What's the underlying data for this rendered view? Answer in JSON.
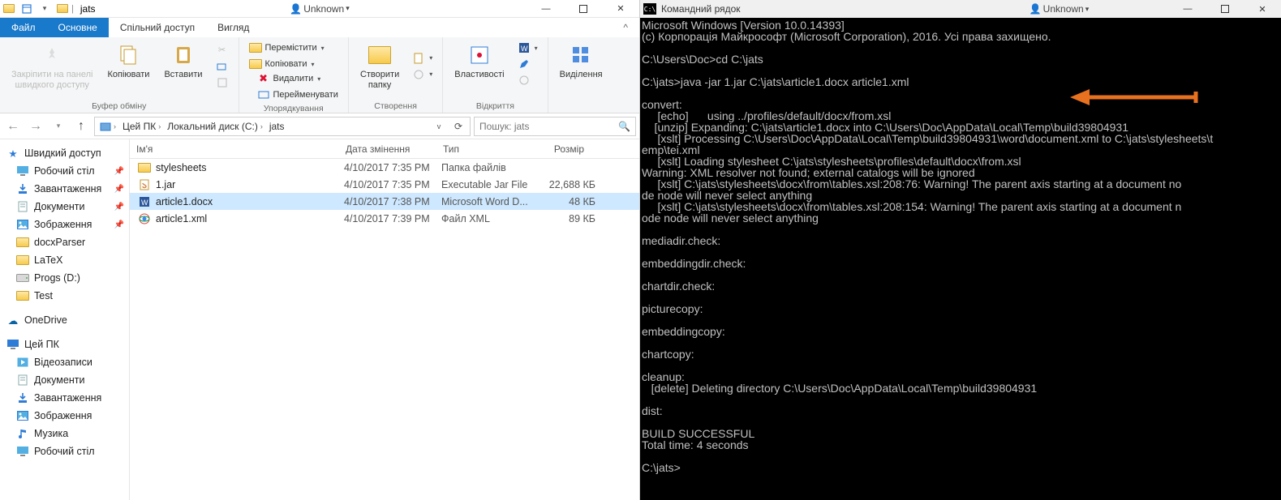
{
  "explorer": {
    "title": "jats",
    "unknown_label": "Unknown",
    "tabs": {
      "file": "Файл",
      "home": "Основне",
      "share": "Спільний доступ",
      "view": "Вигляд"
    },
    "ribbon": {
      "clipboard": {
        "pin": "Закріпити на панелі\nшвидкого доступу",
        "copy": "Копіювати",
        "paste": "Вставити",
        "group": "Буфер обміну"
      },
      "organize": {
        "move": "Перемістити",
        "copyto": "Копіювати",
        "delete": "Видалити",
        "rename": "Перейменувати",
        "group": "Упорядкування"
      },
      "new": {
        "newfolder": "Створити\nпапку",
        "group": "Створення"
      },
      "open": {
        "properties": "Властивості",
        "group": "Відкриття"
      },
      "select": {
        "select": "Виділення"
      }
    },
    "breadcrumb": [
      "Цей ПК",
      "Локальний диск (C:)",
      "jats"
    ],
    "search_placeholder": "Пошук: jats",
    "columns": {
      "name": "Ім'я",
      "date": "Дата змінення",
      "type": "Тип",
      "size": "Розмір"
    },
    "sidebar": {
      "quick": "Швидкий доступ",
      "quick_items": [
        {
          "label": "Робочий стіл",
          "icon": "desktop",
          "pinned": true
        },
        {
          "label": "Завантаження",
          "icon": "downloads",
          "pinned": true
        },
        {
          "label": "Документи",
          "icon": "documents",
          "pinned": true
        },
        {
          "label": "Зображення",
          "icon": "pictures",
          "pinned": true
        },
        {
          "label": "docxParser",
          "icon": "folder",
          "pinned": false
        },
        {
          "label": "LaTeX",
          "icon": "folder",
          "pinned": false
        },
        {
          "label": "Progs (D:)",
          "icon": "drive",
          "pinned": false
        },
        {
          "label": "Test",
          "icon": "folder",
          "pinned": false
        }
      ],
      "onedrive": "OneDrive",
      "thispc": "Цей ПК",
      "pc_items": [
        {
          "label": "Відеозаписи",
          "icon": "videos"
        },
        {
          "label": "Документи",
          "icon": "documents"
        },
        {
          "label": "Завантаження",
          "icon": "downloads"
        },
        {
          "label": "Зображення",
          "icon": "pictures"
        },
        {
          "label": "Музика",
          "icon": "music"
        },
        {
          "label": "Робочий стіл",
          "icon": "desktop"
        }
      ]
    },
    "files": [
      {
        "name": "stylesheets",
        "date": "4/10/2017 7:35 PM",
        "type": "Папка файлів",
        "size": "",
        "icon": "folder",
        "selected": false
      },
      {
        "name": "1.jar",
        "date": "4/10/2017 7:35 PM",
        "type": "Executable Jar File",
        "size": "22,688 КБ",
        "icon": "jar",
        "selected": false
      },
      {
        "name": "article1.docx",
        "date": "4/10/2017 7:38 PM",
        "type": "Microsoft Word D...",
        "size": "48 КБ",
        "icon": "word",
        "selected": true
      },
      {
        "name": "article1.xml",
        "date": "4/10/2017 7:39 PM",
        "type": "Файл XML",
        "size": "89 КБ",
        "icon": "xml",
        "selected": false
      }
    ]
  },
  "terminal": {
    "title": "Командний рядок",
    "unknown_label": "Unknown",
    "lines": [
      "Microsoft Windows [Version 10.0.14393]",
      "(c) Корпорація Майкрософт (Microsoft Corporation), 2016. Усі права захищено.",
      "",
      "C:\\Users\\Doc>cd C:\\jats",
      "",
      "C:\\jats>java -jar 1.jar C:\\jats\\article1.docx article1.xml",
      "",
      "convert:",
      "     [echo]      using ../profiles/default/docx/from.xsl",
      "    [unzip] Expanding: C:\\jats\\article1.docx into C:\\Users\\Doc\\AppData\\Local\\Temp\\build39804931",
      "     [xslt] Processing C:\\Users\\Doc\\AppData\\Local\\Temp\\build39804931\\word\\document.xml to C:\\jats\\stylesheets\\temp\\tei.xml",
      "     [xslt] Loading stylesheet C:\\jats\\stylesheets\\profiles\\default\\docx\\from.xsl",
      "Warning: XML resolver not found; external catalogs will be ignored",
      "     [xslt] C:\\jats\\stylesheets\\docx\\from\\tables.xsl:208:76: Warning! The parent axis starting at a document node node will never select anything",
      "     [xslt] C:\\jats\\stylesheets\\docx\\from\\tables.xsl:208:154: Warning! The parent axis starting at a document node node will never select anything",
      "",
      "mediadir.check:",
      "",
      "embeddingdir.check:",
      "",
      "chartdir.check:",
      "",
      "picturecopy:",
      "",
      "embeddingcopy:",
      "",
      "chartcopy:",
      "",
      "cleanup:",
      "   [delete] Deleting directory C:\\Users\\Doc\\AppData\\Local\\Temp\\build39804931",
      "",
      "dist:",
      "",
      "BUILD SUCCESSFUL",
      "Total time: 4 seconds",
      "",
      "C:\\jats>"
    ]
  }
}
